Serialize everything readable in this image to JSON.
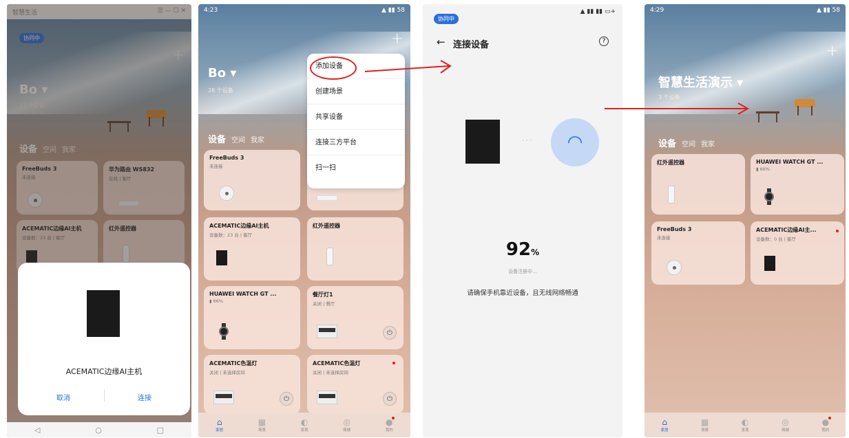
{
  "screen1": {
    "window_title": "智慧生活",
    "status_pill": "协同中",
    "title": "Bo",
    "subtitle": "27 个设备",
    "tabs": [
      "设备",
      "空间",
      "我家"
    ],
    "cards": [
      {
        "name": "FreeBuds 3",
        "status": "未连接"
      },
      {
        "name": "华为路由 WS832",
        "status": "在线 | 客厅"
      },
      {
        "name": "ACEMATIC边缘AI主机",
        "status": "设备数：23 台 | 客厅"
      },
      {
        "name": "红外遥控器",
        "status": ""
      }
    ],
    "dialog": {
      "device": "ACEMATIC边缘AI主机",
      "cancel": "取消",
      "connect": "连接"
    },
    "sysnav": [
      "◁",
      "○",
      "□"
    ]
  },
  "screen2": {
    "time": "4:23",
    "title": "Bo",
    "subtitle": "28 个设备",
    "tabs": [
      "设备",
      "空间",
      "我家"
    ],
    "menu": [
      "添加设备",
      "创建场景",
      "共享设备",
      "连接三方平台",
      "扫一扫"
    ],
    "cards": [
      {
        "name": "FreeBuds 3",
        "status": "未连接"
      },
      {
        "name": "ACEMATIC边缘AI主机",
        "status": "设备数：23 台 | 客厅"
      },
      {
        "name": "红外遥控器",
        "status": ""
      },
      {
        "name": "HUAWEI WATCH GT ...",
        "status": "▮ 66%"
      },
      {
        "name": "餐厅灯1",
        "status": "关闭 | 餐厅"
      },
      {
        "name": "ACEMATIC色温灯",
        "status": "关闭 | 未选择房间"
      },
      {
        "name": "ACEMATIC色温灯",
        "status": "关闭 | 未选择房间"
      }
    ],
    "nav": [
      "家居",
      "场景",
      "发现",
      "商城",
      "我的"
    ]
  },
  "screen3": {
    "status_pill": "协同中",
    "title": "连接设备",
    "percent": "92",
    "percent_unit": "%",
    "progress_status": "设备注册中...",
    "tip": "请确保手机靠近设备，且无线网络畅通"
  },
  "screen4": {
    "time": "4:29",
    "title": "智慧生活演示",
    "subtitle": "3 个设备",
    "tabs": [
      "设备",
      "空间",
      "我家"
    ],
    "cards": [
      {
        "name": "红外遥控器",
        "status": ""
      },
      {
        "name": "HUAWEI WATCH GT ...",
        "status": "▮ 66%"
      },
      {
        "name": "FreeBuds 3",
        "status": "未连接"
      },
      {
        "name": "ACEMATIC边缘AI主...",
        "status": "设备数：0 台 | 客厅"
      }
    ],
    "nav": [
      "家居",
      "场景",
      "发现",
      "商城",
      "我的"
    ]
  },
  "colors": {
    "accent": "#2a6fdb",
    "annotation": "#e02020"
  }
}
